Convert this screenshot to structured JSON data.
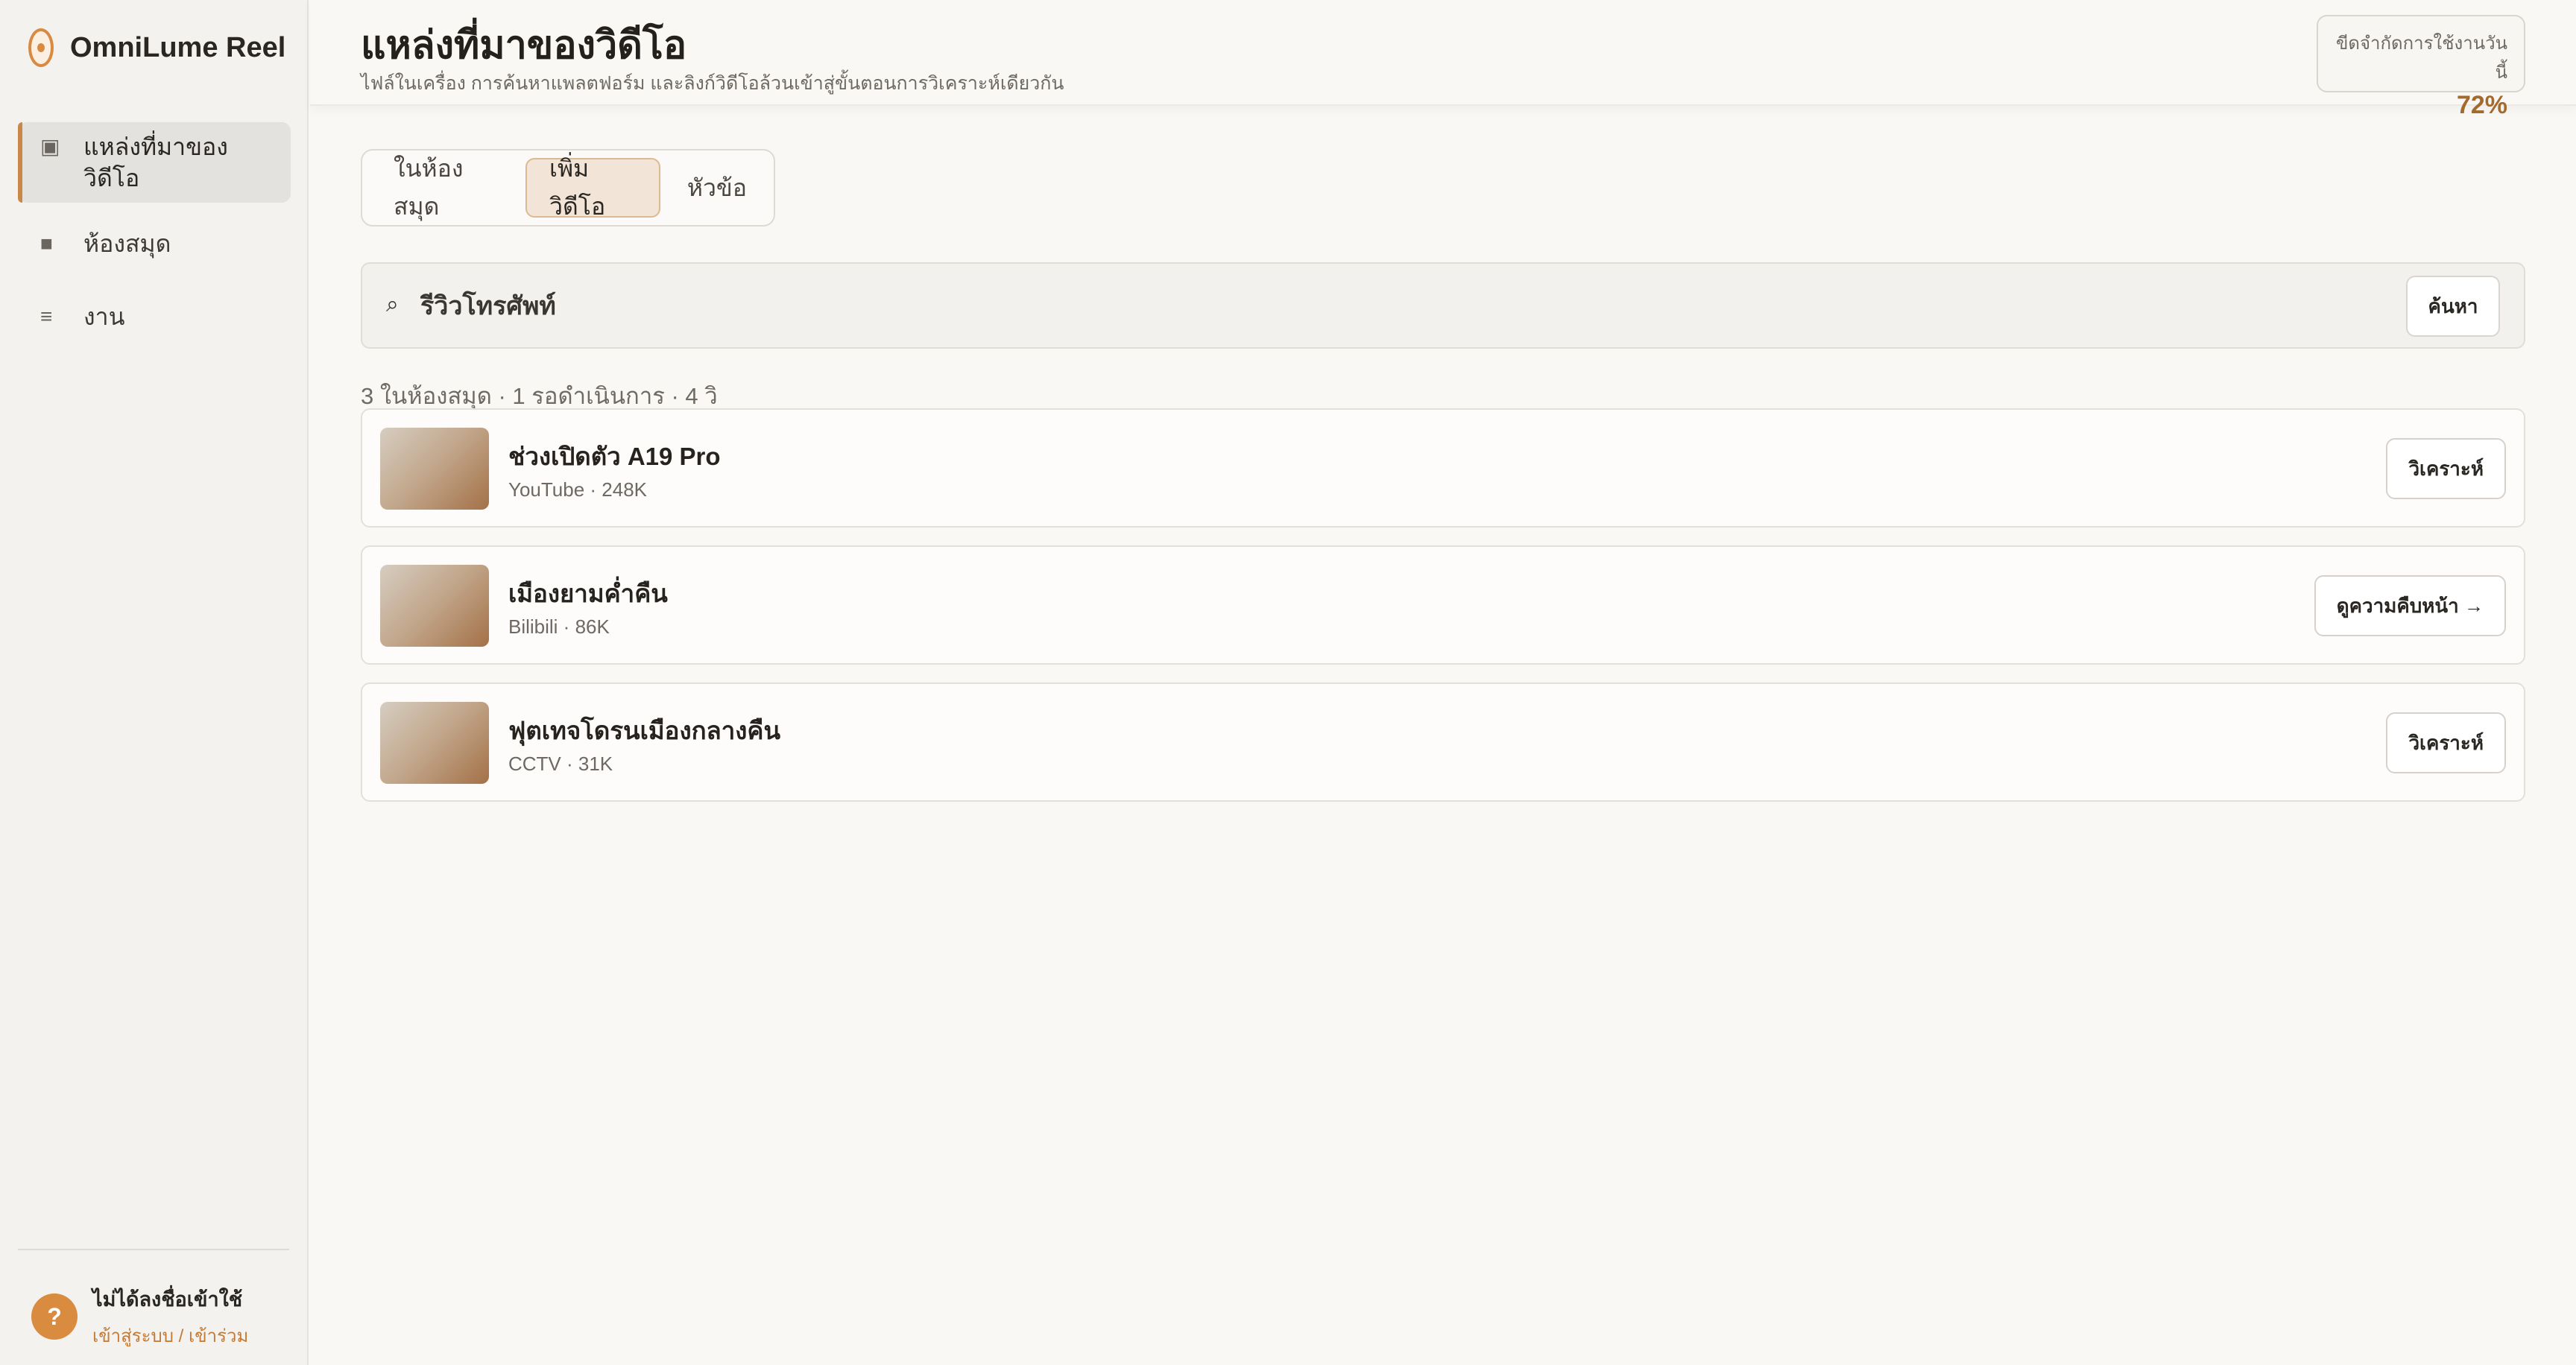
{
  "app": {
    "name": "OmniLume Reel"
  },
  "sidebar": {
    "items": [
      {
        "label": "แหล่งที่มาของวิดีโอ",
        "icon": "▣"
      },
      {
        "label": "ห้องสมุด",
        "icon": "■"
      },
      {
        "label": "งาน",
        "icon": "≡"
      }
    ]
  },
  "user": {
    "avatar": "?",
    "name": "ไม่ได้ลงชื่อเข้าใช้",
    "link": "เข้าสู่ระบบ / เข้าร่วม"
  },
  "header": {
    "title": "แหล่งที่มาของวิดีโอ",
    "subtitle": "ไฟล์ในเครื่อง การค้นหาแพลตฟอร์ม และลิงก์วิดีโอล้วนเข้าสู่ขั้นตอนการวิเคราะห์เดียวกัน",
    "usage_label": "ขีดจำกัดการใช้งานวันนี้",
    "usage_value": "72%"
  },
  "tabs": [
    {
      "label": "ในห้องสมุด"
    },
    {
      "label": "เพิ่มวิดีโอ"
    },
    {
      "label": "หัวข้อ"
    }
  ],
  "search": {
    "icon": "⌕",
    "value": "รีวิวโทรศัพท์",
    "button": "ค้นหา"
  },
  "summary": "3 ในห้องสมุด · 1 รอดำเนินการ · 4 วิ",
  "videos": [
    {
      "title": "ช่วงเปิดตัว A19 Pro",
      "meta": "YouTube · 248K",
      "action": "วิเคราะห์"
    },
    {
      "title": "เมืองยามค่ำคืน",
      "meta": "Bilibili · 86K",
      "action": "ดูความคืบหน้า →"
    },
    {
      "title": "ฟุตเทจโดรนเมืองกลางคืน",
      "meta": "CCTV · 31K",
      "action": "วิเคราะห์"
    }
  ]
}
